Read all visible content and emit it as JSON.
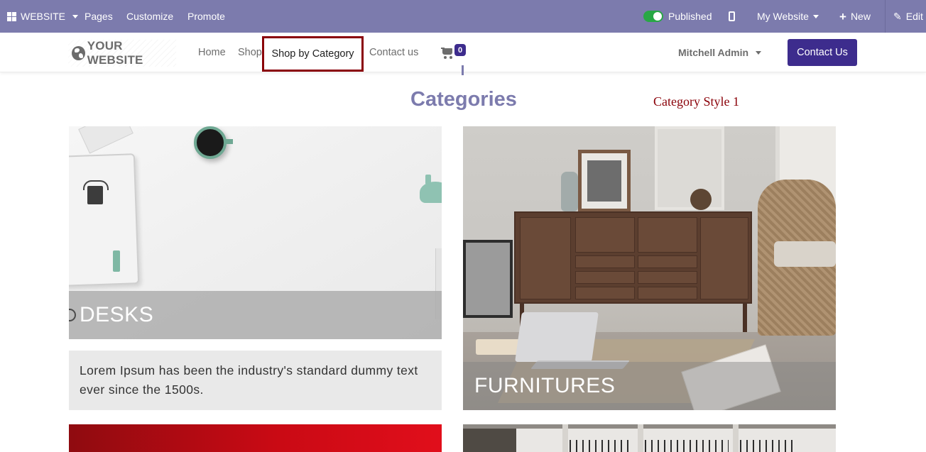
{
  "admin_bar": {
    "website_menu": "WEBSITE",
    "pages": "Pages",
    "customize": "Customize",
    "promote": "Promote",
    "published": "Published",
    "site_selector": "My Website",
    "new": "New",
    "edit": "Edit",
    "published_toggle_on": true
  },
  "header": {
    "logo_text": "YOUR WEBSITE",
    "nav": {
      "home": "Home",
      "shop": "Shop",
      "shop_by_category": "Shop by Category",
      "contact_us": "Contact us"
    },
    "cart_count": "0",
    "user_name": "Mitchell Admin",
    "contact_button": "Contact Us"
  },
  "content": {
    "title": "Categories",
    "style_label": "Category Style 1",
    "categories": [
      {
        "name": "DESKS",
        "description": "Lorem Ipsum has been the industry's standard dummy text ever since the 1500s."
      },
      {
        "name": "FURNITURES"
      }
    ]
  },
  "colors": {
    "admin_bar": "#7c7bad",
    "brand": "#3d2c8d",
    "highlight_border": "#8a0008",
    "toggle_on": "#28a745"
  },
  "icons": [
    "apps-grid-icon",
    "mobile-preview-icon",
    "plus-icon",
    "pencil-icon",
    "globe-icon",
    "cart-icon",
    "caret-down-icon"
  ]
}
